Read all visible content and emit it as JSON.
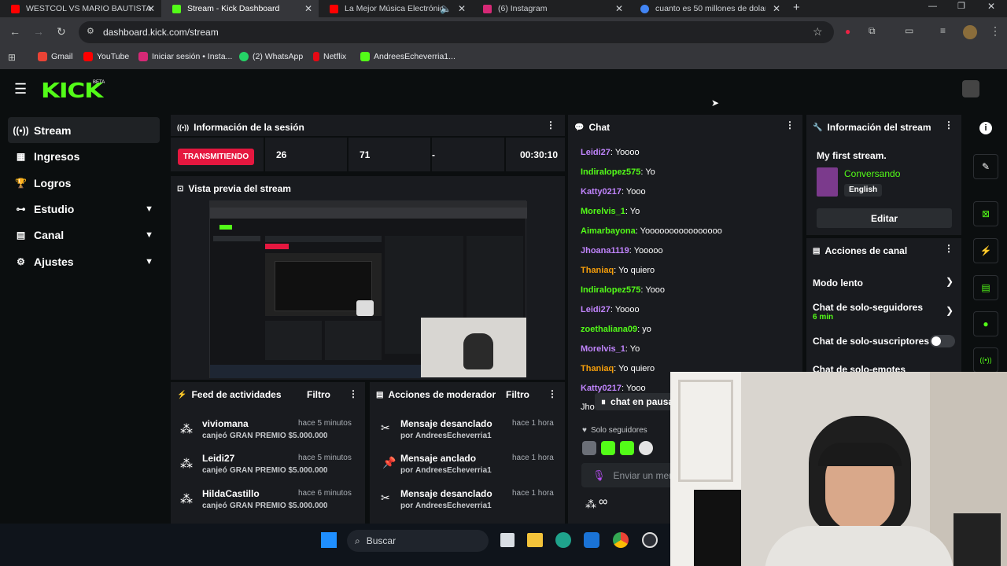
{
  "browser": {
    "tabs": [
      {
        "title": "WESTCOL VS MARIO BAUTISTA",
        "color": "#ff0000"
      },
      {
        "title": "Stream - Kick Dashboard",
        "color": "#53fc18"
      },
      {
        "title": "La Mejor Música Electrónica",
        "color": "#ff0000"
      },
      {
        "title": "(6) Instagram",
        "color": "#d62976"
      },
      {
        "title": "cuanto es 50 millones de dolar",
        "color": "#4285f4"
      }
    ],
    "new_tab": "+",
    "url": "dashboard.kick.com/stream",
    "bookmarks": [
      {
        "label": "Gmail",
        "color": "#ea4335"
      },
      {
        "label": "YouTube",
        "color": "#ff0000"
      },
      {
        "label": "Iniciar sesión • Insta...",
        "color": "#d62976"
      },
      {
        "label": "(2) WhatsApp",
        "color": "#25d366"
      },
      {
        "label": "Netflix",
        "color": "#e50914"
      },
      {
        "label": "AndreesEcheverria1...",
        "color": "#53fc18"
      }
    ]
  },
  "kick": {
    "logo": "KICK",
    "beta": "BETA"
  },
  "sidebar": {
    "items": [
      {
        "label": "Stream",
        "icon": "broadcast-icon"
      },
      {
        "label": "Ingresos",
        "icon": "money-icon"
      },
      {
        "label": "Logros",
        "icon": "trophy-icon"
      },
      {
        "label": "Estudio",
        "icon": "sliders-icon"
      },
      {
        "label": "Canal",
        "icon": "channel-icon"
      },
      {
        "label": "Ajustes",
        "icon": "gear-icon"
      }
    ]
  },
  "session": {
    "title": "Información de la sesión",
    "status": "TRANSMITIENDO",
    "viewers": "26",
    "followers": "71",
    "subs": "-",
    "duration": "00:30:10"
  },
  "preview": {
    "title": "Vista previa del stream"
  },
  "activity": {
    "title": "Feed de actividades",
    "filter": "Filtro",
    "items": [
      {
        "user": "viviomana",
        "time": "hace 5 minutos",
        "action": "canjeó",
        "reward": "GRAN PREMIO $5.000.000"
      },
      {
        "user": "Leidi27",
        "time": "hace 5 minutos",
        "action": "canjeó",
        "reward": "GRAN PREMIO $5.000.000"
      },
      {
        "user": "HildaCastillo",
        "time": "hace 6 minutos",
        "action": "canjeó",
        "reward": "GRAN PREMIO $5.000.000"
      }
    ]
  },
  "modactions": {
    "title": "Acciones de moderador",
    "filter": "Filtro",
    "items": [
      {
        "action": "Mensaje desanclado",
        "time": "hace 1 hora",
        "by": "por",
        "user": "AndreesEcheverria1"
      },
      {
        "action": "Mensaje anclado",
        "time": "hace 1 hora",
        "by": "por",
        "user": "AndreesEcheverria1"
      },
      {
        "action": "Mensaje desanclado",
        "time": "hace 1 hora",
        "by": "por",
        "user": "AndreesEcheverria1"
      }
    ]
  },
  "chat": {
    "title": "Chat",
    "messages": [
      {
        "user": "Leidi27",
        "text": "Yoooo",
        "color": "#c084fc"
      },
      {
        "user": "Indiralopez575",
        "text": "Yo",
        "color": "#53fc18"
      },
      {
        "user": "Katty0217",
        "text": "Yooo",
        "color": "#c084fc"
      },
      {
        "user": "Morelvis_1",
        "text": "Yo",
        "color": "#53fc18"
      },
      {
        "user": "Aimarbayona",
        "text": "Yoooooooooooooooo",
        "color": "#53fc18"
      },
      {
        "user": "Jhoana1119",
        "text": "Yooooo",
        "color": "#c084fc"
      },
      {
        "user": "Thaniaq",
        "text": "Yo quiero",
        "color": "#f59e0b"
      },
      {
        "user": "Indiralopez575",
        "text": "Yooo",
        "color": "#53fc18"
      },
      {
        "user": "Leidi27",
        "text": "Yoooo",
        "color": "#c084fc"
      },
      {
        "user": "zoethaliana09",
        "text": "yo",
        "color": "#53fc18"
      },
      {
        "user": "Morelvis_1",
        "text": "Yo",
        "color": "#c084fc"
      },
      {
        "user": "Thaniaq",
        "text": "Yo quiero",
        "color": "#f59e0b"
      },
      {
        "user": "Katty0217",
        "text": "Yooo",
        "color": "#c084fc"
      }
    ],
    "partial_user": "Jho",
    "paused": "chat en pausa",
    "followers_only": "Solo seguidores",
    "placeholder": "Enviar un mensaje",
    "infinity": "∞"
  },
  "stream_info": {
    "title": "Información del stream",
    "stream_title": "My first stream.",
    "category": "Conversando",
    "language": "English",
    "edit": "Editar"
  },
  "channel_actions": {
    "title": "Acciones de canal",
    "slow_mode": "Modo lento",
    "followers_chat": "Chat de solo-seguidores",
    "followers_chat_value": "6 min",
    "subs_chat": "Chat de solo-suscriptores",
    "emotes_chat": "Chat de solo-emotes"
  },
  "taskbar": {
    "search": "Buscar"
  }
}
